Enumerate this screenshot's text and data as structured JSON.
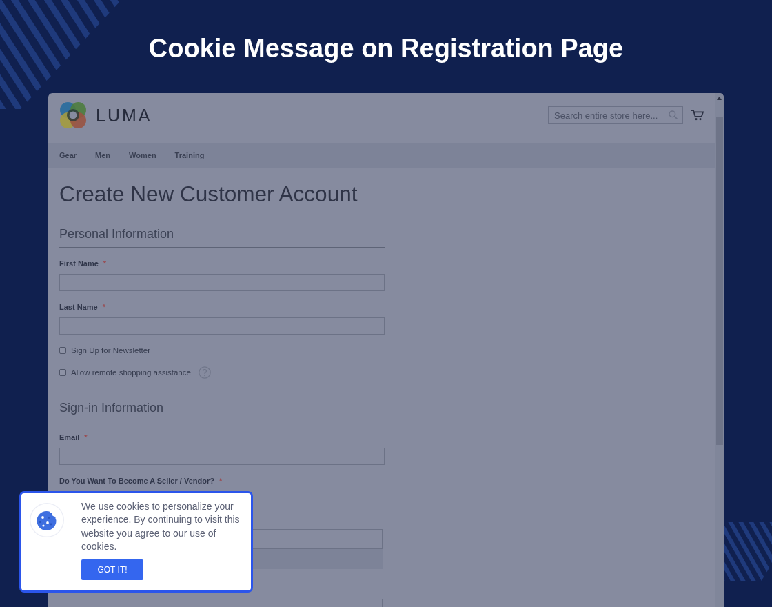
{
  "heading": "Cookie Message on Registration Page",
  "browser": {
    "store": {
      "logo_text": "LUMA",
      "search": {
        "placeholder": "Search entire store here..."
      }
    },
    "nav": [
      "Gear",
      "Men",
      "Women",
      "Training"
    ],
    "page_title": "Create New Customer Account",
    "sections": [
      {
        "title": "Personal Information",
        "fields": [
          {
            "kind": "text",
            "label": "First Name",
            "required_mark": "*"
          },
          {
            "kind": "text",
            "label": "Last Name",
            "required_mark": "*"
          },
          {
            "kind": "checkbox",
            "label": "Sign Up for Newsletter",
            "checked": false
          },
          {
            "kind": "checkbox",
            "label": "Allow remote shopping assistance",
            "checked": false,
            "help": true
          }
        ]
      },
      {
        "title": "Sign-in Information",
        "fields": [
          {
            "kind": "text",
            "label": "Email",
            "required_mark": "*"
          },
          {
            "kind": "question",
            "label": "Do You Want To Become A Seller / Vendor?",
            "required_mark": "*"
          },
          {
            "kind": "input"
          },
          {
            "kind": "note"
          },
          {
            "kind": "input"
          }
        ]
      }
    ]
  },
  "cookie_notice": {
    "message": "We use cookies to personalize your experience. By continuing to visit this website you agree to our use of cookies.",
    "button": "GOT IT!"
  }
}
